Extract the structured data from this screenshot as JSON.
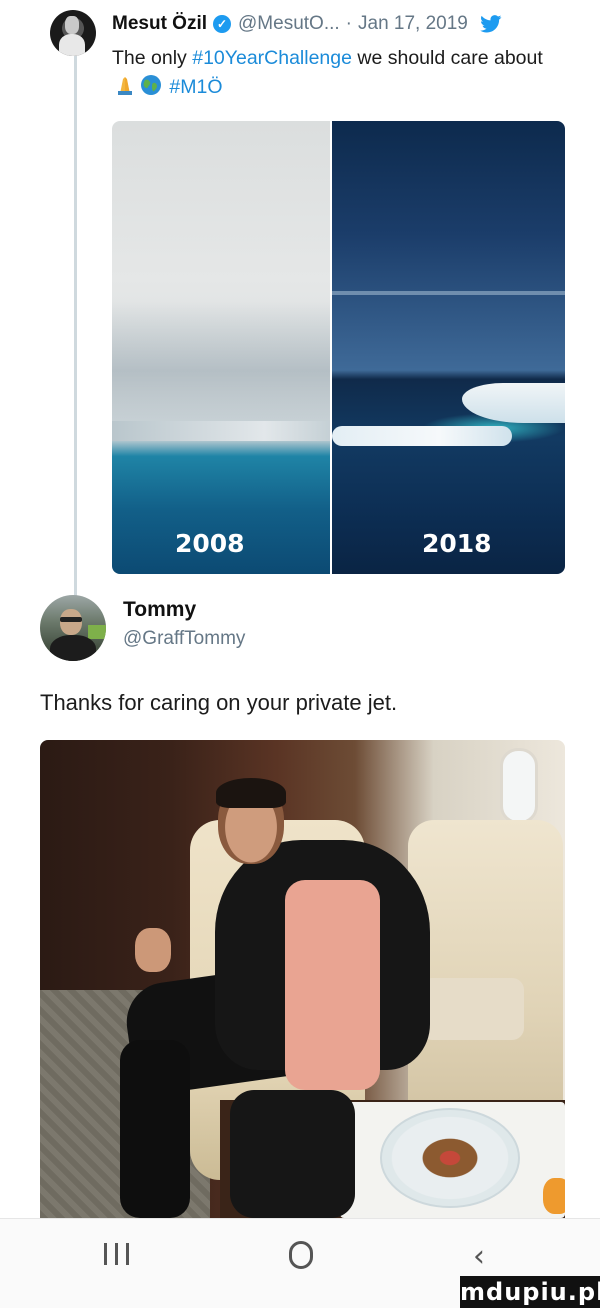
{
  "tweet": {
    "name": "Mesut Özil",
    "handle": "@MesutO...",
    "date": "Jan 17, 2019",
    "text_before": "The only ",
    "hashtag1": "#10YearChallenge",
    "text_after": " we should care about ",
    "hashtag2": "#M1Ö",
    "emoji": [
      "praying-hands",
      "globe-emoji"
    ],
    "image": {
      "left_caption": "2008",
      "right_caption": "2018"
    }
  },
  "reply": {
    "name": "Tommy",
    "handle": "@GraffTommy",
    "text": "Thanks for caring on your private jet."
  },
  "watermark": "mdupiu.pl",
  "colors": {
    "link": "#1b8bd9",
    "verified": "#1d9bf0",
    "muted": "#657786"
  }
}
